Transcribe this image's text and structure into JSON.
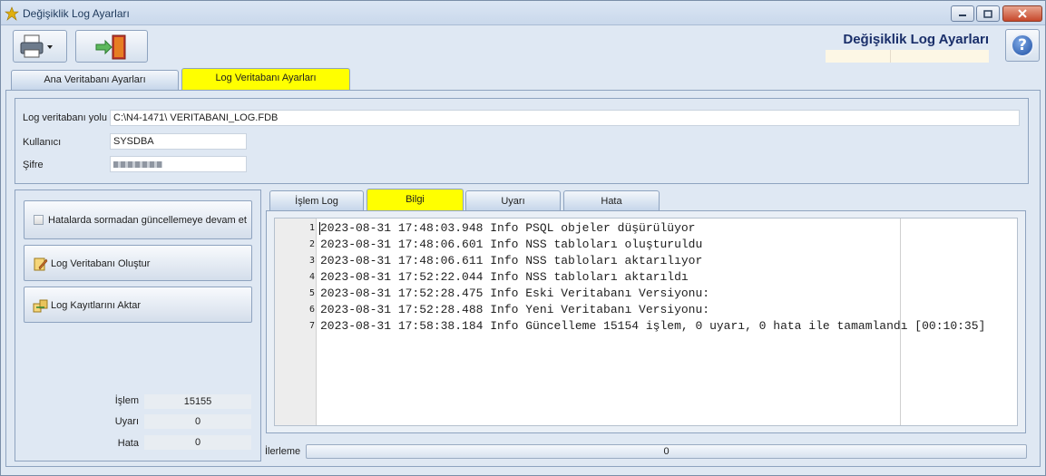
{
  "window": {
    "title": "Değişiklik Log Ayarları"
  },
  "header": {
    "title": "Değişiklik Log Ayarları",
    "help_icon_text": "?"
  },
  "toolbar": {
    "print_icon": "printer-icon",
    "exit_icon": "exit-door-icon"
  },
  "tabs": [
    {
      "label": "Ana Veritabanı Ayarları",
      "active": false
    },
    {
      "label": "Log Veritabanı Ayarları",
      "active": true
    }
  ],
  "form": {
    "path_label": "Log veritabanı yolu",
    "path_value": "C:\\N4-1471\\ VERITABANI_LOG.FDB",
    "user_label": "Kullanıcı",
    "user_value": "SYSDBA",
    "password_label": "Şifre"
  },
  "side": {
    "checkbox_label": "Hatalarda sormadan güncellemeye devam et",
    "checkbox_checked": false,
    "create_button": "Log Veritabanı Oluştur",
    "transfer_button": "Log Kayıtlarını Aktar",
    "stats": [
      {
        "label": "İşlem",
        "value": "15155"
      },
      {
        "label": "Uyarı",
        "value": "0"
      },
      {
        "label": "Hata",
        "value": "0"
      }
    ]
  },
  "log_tabs": [
    {
      "label": "İşlem Log",
      "active": false
    },
    {
      "label": "Bilgi",
      "active": true
    },
    {
      "label": "Uyarı",
      "active": false
    },
    {
      "label": "Hata",
      "active": false
    }
  ],
  "log_lines": [
    {
      "n": "1",
      "text": "2023-08-31 17:48:03.948 Info PSQL objeler düşürülüyor"
    },
    {
      "n": "2",
      "text": "2023-08-31 17:48:06.601 Info NSS tabloları oluşturuldu"
    },
    {
      "n": "3",
      "text": "2023-08-31 17:48:06.611 Info NSS tabloları aktarılıyor"
    },
    {
      "n": "4",
      "text": "2023-08-31 17:52:22.044 Info NSS tabloları aktarıldı"
    },
    {
      "n": "5",
      "text": "2023-08-31 17:52:28.475 Info Eski Veritabanı Versiyonu:"
    },
    {
      "n": "6",
      "text": "2023-08-31 17:52:28.488 Info Yeni Veritabanı Versiyonu:"
    },
    {
      "n": "7",
      "text": "2023-08-31 17:58:38.184 Info Güncelleme 15154 işlem, 0 uyarı, 0 hata ile tamamlandı [00:10:35]"
    }
  ],
  "progress": {
    "label": "İlerleme",
    "value": "0",
    "fraction": 0
  },
  "colors": {
    "active_tab": "#ffff00",
    "header_title": "#1a2f6a",
    "window_bg": "#dfe8f3"
  }
}
